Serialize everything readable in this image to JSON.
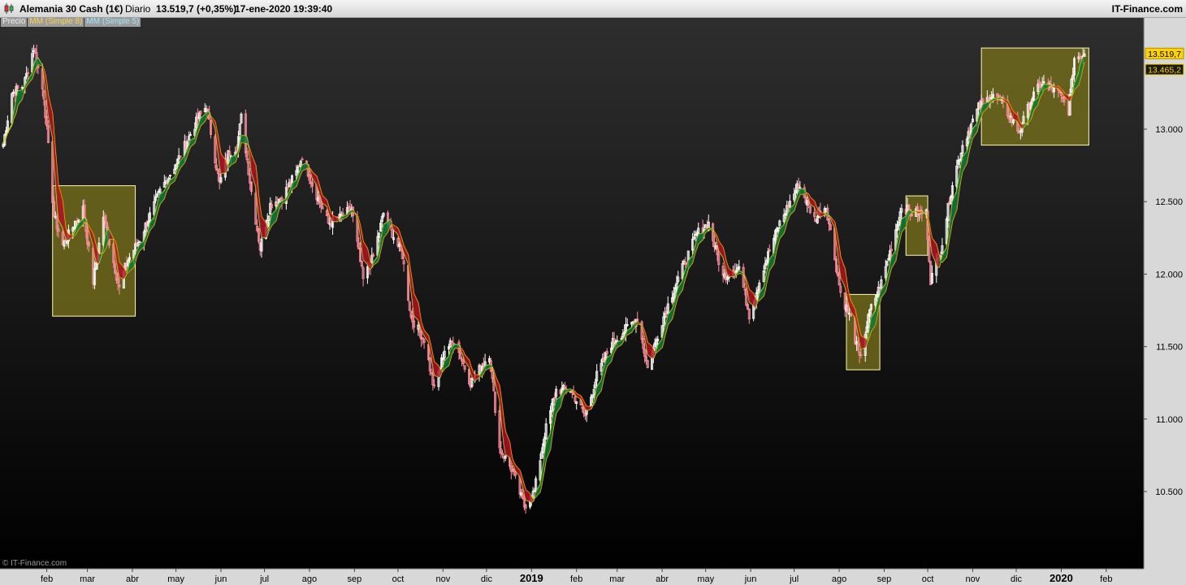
{
  "header": {
    "instrument": "Alemania 30 Cash (1€)",
    "period": "Diario",
    "price_change": "13.519,7 (+0,35%)",
    "datetime": "17-ene-2020 19:39:40",
    "brand": "IT-Finance.com"
  },
  "legend": {
    "price": "Precio",
    "ma1": "MM (Simple 8)",
    "ma2": "MM (Simple 5)"
  },
  "copyright": "© IT-Finance.com",
  "colors": {
    "up_candle": "#ffffff",
    "down_candle": "#ff8fa0",
    "up_fill": "#0f7a3a",
    "down_fill": "#b01226",
    "ma1": "#ffb000",
    "ma2": "#c6e22a",
    "highlight_box": "#fffbb0",
    "price_tag": "#ffd200"
  },
  "chart_data": {
    "type": "candlestick",
    "y_axis": {
      "ticks": [
        10500,
        11000,
        11500,
        12000,
        12500,
        13000
      ],
      "tick_labels": [
        "10.500",
        "11.000",
        "11.500",
        "12.000",
        "12.500",
        "13.000"
      ],
      "range": [
        10120,
        13800
      ]
    },
    "x_axis": {
      "labels": [
        {
          "label": "feb",
          "date": "2018-02-01"
        },
        {
          "label": "mar",
          "date": "2018-03-01"
        },
        {
          "label": "abr",
          "date": "2018-04-01"
        },
        {
          "label": "may",
          "date": "2018-05-01"
        },
        {
          "label": "jun",
          "date": "2018-06-01"
        },
        {
          "label": "jul",
          "date": "2018-07-01"
        },
        {
          "label": "ago",
          "date": "2018-08-01"
        },
        {
          "label": "sep",
          "date": "2018-09-01"
        },
        {
          "label": "oct",
          "date": "2018-10-01"
        },
        {
          "label": "nov",
          "date": "2018-11-01"
        },
        {
          "label": "dic",
          "date": "2018-12-01"
        },
        {
          "label": "2019",
          "date": "2019-01-01",
          "bold": true
        },
        {
          "label": "feb",
          "date": "2019-02-01"
        },
        {
          "label": "mar",
          "date": "2019-03-01"
        },
        {
          "label": "abr",
          "date": "2019-04-01"
        },
        {
          "label": "may",
          "date": "2019-05-01"
        },
        {
          "label": "jun",
          "date": "2019-06-01"
        },
        {
          "label": "jul",
          "date": "2019-07-01"
        },
        {
          "label": "ago",
          "date": "2019-08-01"
        },
        {
          "label": "sep",
          "date": "2019-09-01"
        },
        {
          "label": "oct",
          "date": "2019-10-01"
        },
        {
          "label": "nov",
          "date": "2019-11-01"
        },
        {
          "label": "dic",
          "date": "2019-12-01"
        },
        {
          "label": "2020",
          "date": "2020-01-01",
          "bold": true
        },
        {
          "label": "feb",
          "date": "2020-02-01"
        }
      ]
    },
    "close_path": [
      [
        "2018-01-02",
        12900
      ],
      [
        "2018-01-08",
        13250
      ],
      [
        "2018-01-16",
        13300
      ],
      [
        "2018-01-23",
        13560
      ],
      [
        "2018-01-30",
        13230
      ],
      [
        "2018-02-06",
        12400
      ],
      [
        "2018-02-12",
        12200
      ],
      [
        "2018-02-26",
        12450
      ],
      [
        "2018-03-05",
        11950
      ],
      [
        "2018-03-12",
        12400
      ],
      [
        "2018-03-23",
        11900
      ],
      [
        "2018-03-28",
        12080
      ],
      [
        "2018-04-06",
        12240
      ],
      [
        "2018-04-20",
        12570
      ],
      [
        "2018-05-02",
        12780
      ],
      [
        "2018-05-16",
        13070
      ],
      [
        "2018-05-22",
        13160
      ],
      [
        "2018-05-31",
        12620
      ],
      [
        "2018-06-06",
        12830
      ],
      [
        "2018-06-12",
        12880
      ],
      [
        "2018-06-15",
        13080
      ],
      [
        "2018-06-22",
        12570
      ],
      [
        "2018-06-28",
        12180
      ],
      [
        "2018-07-05",
        12480
      ],
      [
        "2018-07-13",
        12530
      ],
      [
        "2018-07-23",
        12700
      ],
      [
        "2018-07-27",
        12820
      ],
      [
        "2018-08-03",
        12620
      ],
      [
        "2018-08-14",
        12350
      ],
      [
        "2018-08-21",
        12380
      ],
      [
        "2018-08-30",
        12450
      ],
      [
        "2018-09-07",
        11960
      ],
      [
        "2018-09-14",
        12120
      ],
      [
        "2018-09-21",
        12420
      ],
      [
        "2018-09-28",
        12260
      ],
      [
        "2018-10-04",
        12130
      ],
      [
        "2018-10-10",
        11700
      ],
      [
        "2018-10-19",
        11550
      ],
      [
        "2018-10-26",
        11200
      ],
      [
        "2018-11-02",
        11480
      ],
      [
        "2018-11-09",
        11540
      ],
      [
        "2018-11-20",
        11250
      ],
      [
        "2018-12-03",
        11450
      ],
      [
        "2018-12-10",
        10800
      ],
      [
        "2018-12-19",
        10640
      ],
      [
        "2018-12-27",
        10400
      ],
      [
        "2019-01-03",
        10500
      ],
      [
        "2019-01-10",
        10900
      ],
      [
        "2019-01-18",
        11200
      ],
      [
        "2019-01-28",
        11200
      ],
      [
        "2019-02-07",
        11020
      ],
      [
        "2019-02-15",
        11300
      ],
      [
        "2019-02-25",
        11520
      ],
      [
        "2019-03-05",
        11600
      ],
      [
        "2019-03-15",
        11700
      ],
      [
        "2019-03-22",
        11350
      ],
      [
        "2019-04-01",
        11680
      ],
      [
        "2019-04-10",
        11920
      ],
      [
        "2019-04-25",
        12280
      ],
      [
        "2019-05-03",
        12350
      ],
      [
        "2019-05-13",
        11980
      ],
      [
        "2019-05-24",
        12050
      ],
      [
        "2019-05-31",
        11720
      ],
      [
        "2019-06-10",
        12050
      ],
      [
        "2019-06-20",
        12330
      ],
      [
        "2019-07-04",
        12620
      ],
      [
        "2019-07-15",
        12380
      ],
      [
        "2019-07-23",
        12470
      ],
      [
        "2019-08-02",
        11870
      ],
      [
        "2019-08-09",
        11690
      ],
      [
        "2019-08-15",
        11410
      ],
      [
        "2019-08-22",
        11740
      ],
      [
        "2019-08-30",
        11940
      ],
      [
        "2019-09-06",
        12190
      ],
      [
        "2019-09-13",
        12470
      ],
      [
        "2019-09-20",
        12420
      ],
      [
        "2019-09-30",
        12420
      ],
      [
        "2019-10-03",
        11960
      ],
      [
        "2019-10-10",
        12160
      ],
      [
        "2019-10-18",
        12630
      ],
      [
        "2019-10-25",
        12890
      ],
      [
        "2019-11-05",
        13150
      ],
      [
        "2019-11-15",
        13240
      ],
      [
        "2019-11-22",
        13160
      ],
      [
        "2019-12-03",
        12980
      ],
      [
        "2019-12-12",
        13220
      ],
      [
        "2019-12-19",
        13320
      ],
      [
        "2019-12-30",
        13250
      ],
      [
        "2020-01-06",
        13130
      ],
      [
        "2020-01-10",
        13490
      ],
      [
        "2020-01-17",
        13520
      ]
    ],
    "highlight_boxes": [
      {
        "from": "2018-02-05",
        "to": "2018-04-03",
        "low": 11710,
        "high": 12610
      },
      {
        "from": "2019-08-06",
        "to": "2019-08-29",
        "low": 11340,
        "high": 11860
      },
      {
        "from": "2019-09-16",
        "to": "2019-10-01",
        "low": 12130,
        "high": 12540
      },
      {
        "from": "2019-11-07",
        "to": "2020-01-20",
        "low": 12890,
        "high": 13560
      }
    ],
    "price_labels": [
      {
        "value": 13519.7,
        "text": "13.519,7",
        "style": "last"
      },
      {
        "value": 13465.2,
        "text": "13.465,2",
        "style": "ma"
      }
    ]
  }
}
